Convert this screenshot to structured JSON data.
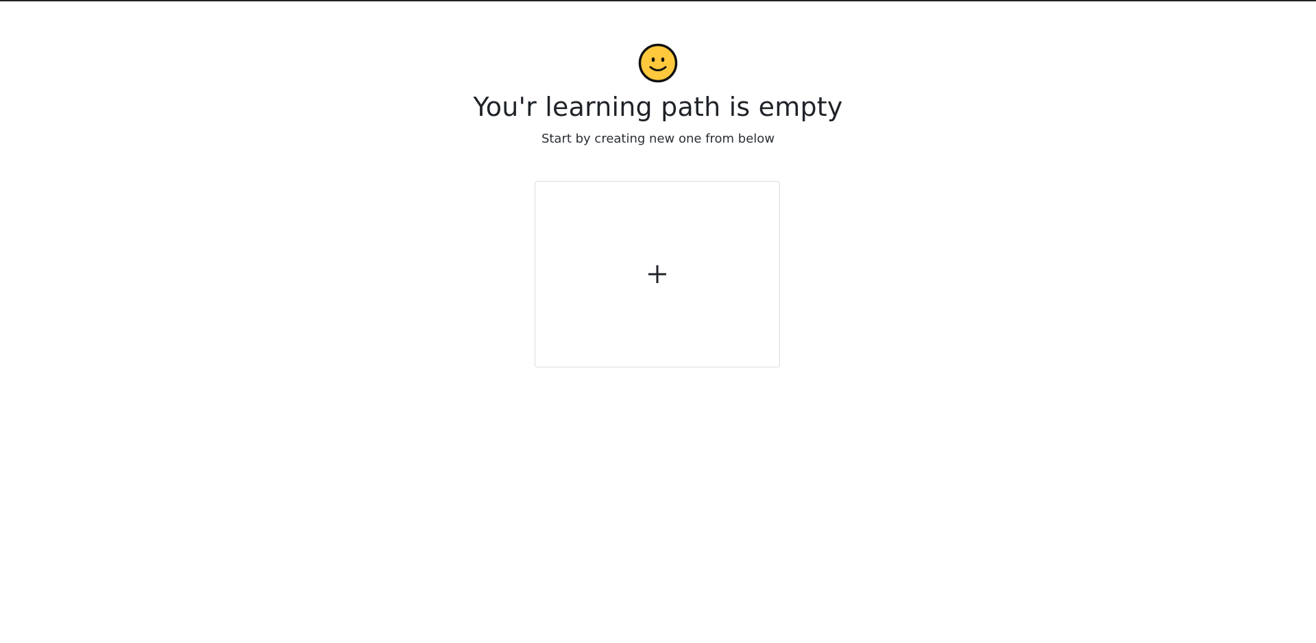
{
  "empty_state": {
    "icon": "smiley-face-icon",
    "title": "You'r learning path is empty",
    "subtitle": "Start by creating new one from below"
  },
  "create_card": {
    "icon": "plus-icon"
  },
  "colors": {
    "smiley_fill": "#FFC83D",
    "smiley_stroke": "#111111",
    "text": "#1F2328",
    "card_border": "#DCDCDC",
    "top_border": "#222222"
  }
}
